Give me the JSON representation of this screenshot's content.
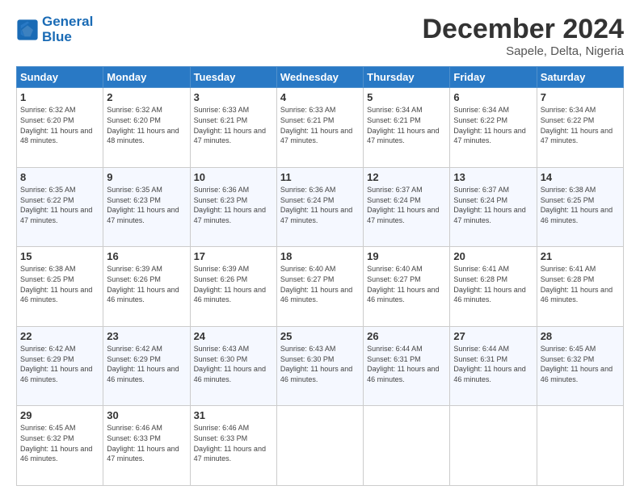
{
  "header": {
    "logo_line1": "General",
    "logo_line2": "Blue",
    "month": "December 2024",
    "location": "Sapele, Delta, Nigeria"
  },
  "weekdays": [
    "Sunday",
    "Monday",
    "Tuesday",
    "Wednesday",
    "Thursday",
    "Friday",
    "Saturday"
  ],
  "weeks": [
    [
      {
        "day": "1",
        "sunrise": "6:32 AM",
        "sunset": "6:20 PM",
        "daylight": "11 hours and 48 minutes."
      },
      {
        "day": "2",
        "sunrise": "6:32 AM",
        "sunset": "6:20 PM",
        "daylight": "11 hours and 48 minutes."
      },
      {
        "day": "3",
        "sunrise": "6:33 AM",
        "sunset": "6:21 PM",
        "daylight": "11 hours and 47 minutes."
      },
      {
        "day": "4",
        "sunrise": "6:33 AM",
        "sunset": "6:21 PM",
        "daylight": "11 hours and 47 minutes."
      },
      {
        "day": "5",
        "sunrise": "6:34 AM",
        "sunset": "6:21 PM",
        "daylight": "11 hours and 47 minutes."
      },
      {
        "day": "6",
        "sunrise": "6:34 AM",
        "sunset": "6:22 PM",
        "daylight": "11 hours and 47 minutes."
      },
      {
        "day": "7",
        "sunrise": "6:34 AM",
        "sunset": "6:22 PM",
        "daylight": "11 hours and 47 minutes."
      }
    ],
    [
      {
        "day": "8",
        "sunrise": "6:35 AM",
        "sunset": "6:22 PM",
        "daylight": "11 hours and 47 minutes."
      },
      {
        "day": "9",
        "sunrise": "6:35 AM",
        "sunset": "6:23 PM",
        "daylight": "11 hours and 47 minutes."
      },
      {
        "day": "10",
        "sunrise": "6:36 AM",
        "sunset": "6:23 PM",
        "daylight": "11 hours and 47 minutes."
      },
      {
        "day": "11",
        "sunrise": "6:36 AM",
        "sunset": "6:24 PM",
        "daylight": "11 hours and 47 minutes."
      },
      {
        "day": "12",
        "sunrise": "6:37 AM",
        "sunset": "6:24 PM",
        "daylight": "11 hours and 47 minutes."
      },
      {
        "day": "13",
        "sunrise": "6:37 AM",
        "sunset": "6:24 PM",
        "daylight": "11 hours and 47 minutes."
      },
      {
        "day": "14",
        "sunrise": "6:38 AM",
        "sunset": "6:25 PM",
        "daylight": "11 hours and 46 minutes."
      }
    ],
    [
      {
        "day": "15",
        "sunrise": "6:38 AM",
        "sunset": "6:25 PM",
        "daylight": "11 hours and 46 minutes."
      },
      {
        "day": "16",
        "sunrise": "6:39 AM",
        "sunset": "6:26 PM",
        "daylight": "11 hours and 46 minutes."
      },
      {
        "day": "17",
        "sunrise": "6:39 AM",
        "sunset": "6:26 PM",
        "daylight": "11 hours and 46 minutes."
      },
      {
        "day": "18",
        "sunrise": "6:40 AM",
        "sunset": "6:27 PM",
        "daylight": "11 hours and 46 minutes."
      },
      {
        "day": "19",
        "sunrise": "6:40 AM",
        "sunset": "6:27 PM",
        "daylight": "11 hours and 46 minutes."
      },
      {
        "day": "20",
        "sunrise": "6:41 AM",
        "sunset": "6:28 PM",
        "daylight": "11 hours and 46 minutes."
      },
      {
        "day": "21",
        "sunrise": "6:41 AM",
        "sunset": "6:28 PM",
        "daylight": "11 hours and 46 minutes."
      }
    ],
    [
      {
        "day": "22",
        "sunrise": "6:42 AM",
        "sunset": "6:29 PM",
        "daylight": "11 hours and 46 minutes."
      },
      {
        "day": "23",
        "sunrise": "6:42 AM",
        "sunset": "6:29 PM",
        "daylight": "11 hours and 46 minutes."
      },
      {
        "day": "24",
        "sunrise": "6:43 AM",
        "sunset": "6:30 PM",
        "daylight": "11 hours and 46 minutes."
      },
      {
        "day": "25",
        "sunrise": "6:43 AM",
        "sunset": "6:30 PM",
        "daylight": "11 hours and 46 minutes."
      },
      {
        "day": "26",
        "sunrise": "6:44 AM",
        "sunset": "6:31 PM",
        "daylight": "11 hours and 46 minutes."
      },
      {
        "day": "27",
        "sunrise": "6:44 AM",
        "sunset": "6:31 PM",
        "daylight": "11 hours and 46 minutes."
      },
      {
        "day": "28",
        "sunrise": "6:45 AM",
        "sunset": "6:32 PM",
        "daylight": "11 hours and 46 minutes."
      }
    ],
    [
      {
        "day": "29",
        "sunrise": "6:45 AM",
        "sunset": "6:32 PM",
        "daylight": "11 hours and 46 minutes."
      },
      {
        "day": "30",
        "sunrise": "6:46 AM",
        "sunset": "6:33 PM",
        "daylight": "11 hours and 47 minutes."
      },
      {
        "day": "31",
        "sunrise": "6:46 AM",
        "sunset": "6:33 PM",
        "daylight": "11 hours and 47 minutes."
      },
      null,
      null,
      null,
      null
    ]
  ]
}
